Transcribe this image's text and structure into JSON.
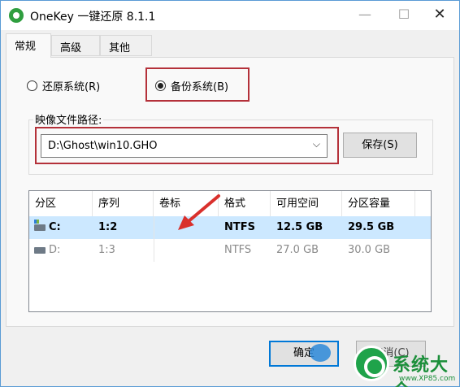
{
  "window": {
    "title": "OneKey 一键还原 8.1.1",
    "min_symbol": "—",
    "max_symbol": "☐",
    "close_symbol": "✕"
  },
  "tabs": [
    {
      "label": "常规",
      "active": true
    },
    {
      "label": "高级",
      "active": false
    },
    {
      "label": "其他",
      "active": false
    }
  ],
  "mode": {
    "restore_label": "还原系统(R)",
    "backup_label": "备份系统(B)",
    "selected": "backup"
  },
  "image_path": {
    "group_label": "映像文件路径:",
    "value": "D:\\Ghost\\win10.GHO",
    "dropdown_icon": "chevron-down-icon",
    "save_label": "保存(S)"
  },
  "partitions": {
    "headers": [
      "分区",
      "序列",
      "卷标",
      "格式",
      "可用空间",
      "分区容量"
    ],
    "rows": [
      {
        "drive": "C:",
        "index": "1:2",
        "label": "",
        "format": "NTFS",
        "free": "12.5 GB",
        "capacity": "29.5 GB",
        "selected": true
      },
      {
        "drive": "D:",
        "index": "1:3",
        "label": "",
        "format": "NTFS",
        "free": "27.0 GB",
        "capacity": "30.0 GB",
        "selected": false
      }
    ]
  },
  "footer": {
    "ok_label": "确定",
    "cancel_label": "取消(C)"
  },
  "watermark": {
    "text": "系统大全",
    "url": "www.XP85.com"
  },
  "colors": {
    "highlight_box": "#b4313a",
    "selected_row": "#cce8ff",
    "arrow": "#d9302c",
    "ok_focus": "#0078d7"
  }
}
